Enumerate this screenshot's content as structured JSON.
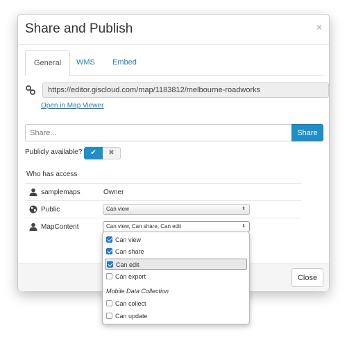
{
  "dialog": {
    "title": "Share and Publish",
    "close_symbol": "×"
  },
  "tabs": [
    {
      "label": "General",
      "active": true
    },
    {
      "label": "WMS",
      "active": false
    },
    {
      "label": "Embed",
      "active": false
    }
  ],
  "general": {
    "link_icon": "link-icon",
    "map_url": "https://editor.giscloud.com/map/1183812/melbourne-roadworks",
    "open_link_label": "Open in Map Viewer",
    "share_placeholder": "Share...",
    "share_button_label": "Share",
    "publicly_label": "Publicly available?",
    "toggle_on_symbol": "✔",
    "toggle_off_symbol": "✖",
    "access_title": "Who has access"
  },
  "access_rows": [
    {
      "name": "samplemaps",
      "icon": "user-icon",
      "role": "Owner",
      "permission": null
    },
    {
      "name": "Public",
      "icon": "globe-icon",
      "role": null,
      "permission": "Can view"
    },
    {
      "name": "MapContent",
      "icon": "user-icon",
      "role": null,
      "permission": "Can view, Can share, Can edit"
    }
  ],
  "dropdown": {
    "options": [
      {
        "label": "Can view",
        "checked": true
      },
      {
        "label": "Can share",
        "checked": true
      },
      {
        "label": "Can edit",
        "checked": true,
        "highlighted": true
      },
      {
        "label": "Can export",
        "checked": false
      }
    ],
    "group_title": "Mobile Data Collection",
    "group_options": [
      {
        "label": "Can collect",
        "checked": false
      },
      {
        "label": "Can update",
        "checked": false
      }
    ]
  },
  "footer": {
    "close_button_label": "Close"
  },
  "colors": {
    "accent": "#1e8fc8",
    "link": "#2a7bb5",
    "checkbox": "#1c7fd6"
  }
}
